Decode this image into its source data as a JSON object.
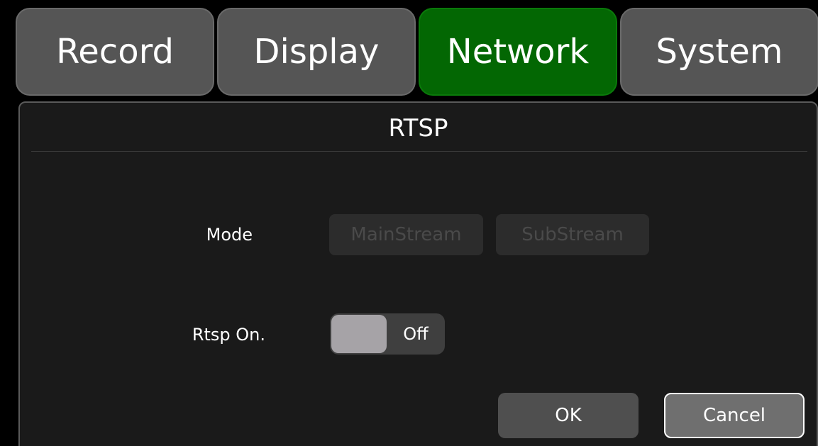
{
  "tabs": [
    {
      "label": "Record"
    },
    {
      "label": "Display"
    },
    {
      "label": "Network"
    },
    {
      "label": "System"
    }
  ],
  "active_tab": "Network",
  "colors": {
    "background": "#000000",
    "panel": "#1a1a1a",
    "tab": "#555555",
    "tab_active": "#036703",
    "toggle_knob": "#a6a3a7"
  },
  "panel": {
    "title": "RTSP"
  },
  "mode": {
    "label": "Mode",
    "options": [
      "MainStream",
      "SubStream"
    ]
  },
  "rtsp_on": {
    "label": "Rtsp On.",
    "state": "Off"
  },
  "actions": {
    "ok_label": "OK",
    "cancel_label": "Cancel"
  }
}
